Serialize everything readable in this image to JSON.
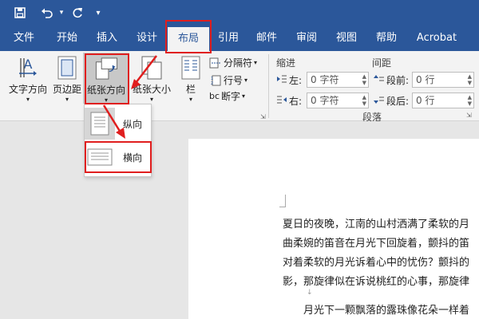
{
  "quick_access": {
    "save": "save-icon",
    "undo": "undo-icon",
    "redo": "redo-icon",
    "customize": "▾"
  },
  "tabs": [
    {
      "label": "文件"
    },
    {
      "label": "开始"
    },
    {
      "label": "插入"
    },
    {
      "label": "设计"
    },
    {
      "label": "布局",
      "active": true
    },
    {
      "label": "引用"
    },
    {
      "label": "邮件"
    },
    {
      "label": "审阅"
    },
    {
      "label": "视图"
    },
    {
      "label": "帮助"
    },
    {
      "label": "Acrobat"
    }
  ],
  "ribbon": {
    "page_setup": {
      "text_direction": "文字方向",
      "margins": "页边距",
      "orientation": "纸张方向",
      "size": "纸张大小",
      "columns": "栏",
      "breaks": "分隔符",
      "line_numbers": "行号",
      "hyphenation": "断字"
    },
    "paragraph": {
      "indent_title": "缩进",
      "spacing_title": "间距",
      "left_label": "左:",
      "left_value": "0 字符",
      "right_label": "右:",
      "right_value": "0 字符",
      "before_label": "段前:",
      "before_value": "0 行",
      "after_label": "段后:",
      "after_value": "0 行",
      "group_name": "段落"
    }
  },
  "orientation_menu": {
    "portrait": "纵向",
    "landscape": "横向"
  },
  "document": {
    "lines": [
      "夏日的夜晚，江南的山村洒满了柔软的月",
      "曲柔婉的笛音在月光下回旋着，颤抖的笛",
      "对着柔软的月光诉着心中的忧伤？颤抖的",
      "影，那旋律似在诉说桃红的心事，那旋律",
      "↓",
      "　　月光下一颗飘落的露珠像花朵一样着"
    ]
  },
  "colors": {
    "brand": "#2b579a",
    "highlight": "#e01e1e"
  }
}
